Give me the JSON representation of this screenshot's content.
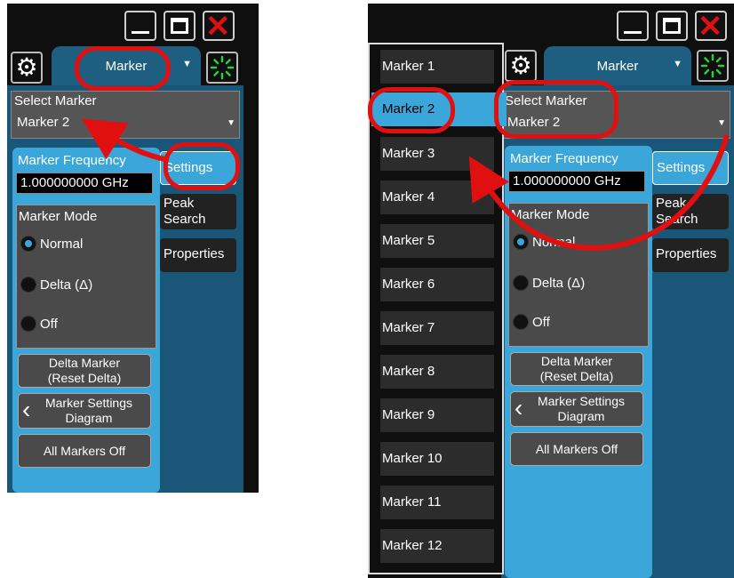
{
  "left": {
    "tab_label": "Marker",
    "select_marker": {
      "label": "Select Marker",
      "value": "Marker 2"
    },
    "marker_frequency": {
      "label": "Marker Frequency",
      "value": "1.000000000 GHz"
    },
    "marker_mode": {
      "label": "Marker Mode",
      "options": [
        "Normal",
        "Delta (Δ)",
        "Off"
      ],
      "selected": "Normal"
    },
    "buttons": {
      "delta_marker": "Delta Marker\n(Reset Delta)",
      "settings_diagram": "Marker Settings\nDiagram",
      "all_off": "All Markers Off"
    },
    "side_tabs": {
      "settings": "Settings",
      "peak_search": "Peak\nSearch",
      "properties": "Properties"
    }
  },
  "right": {
    "tab_label": "Marker",
    "select_marker": {
      "label": "Select Marker",
      "value": "Marker 2"
    },
    "marker_frequency": {
      "label": "Marker Frequency",
      "value": "1.000000000 GHz"
    },
    "marker_mode": {
      "label": "Marker Mode",
      "options": [
        "Normal",
        "Delta (Δ)",
        "Off"
      ],
      "selected": "Normal"
    },
    "buttons": {
      "delta_marker": "Delta Marker\n(Reset Delta)",
      "settings_diagram": "Marker Settings\nDiagram",
      "all_off": "All Markers Off"
    },
    "side_tabs": {
      "settings": "Settings",
      "peak_search": "Peak\nSearch",
      "properties": "Properties"
    },
    "marker_list": [
      "Marker 1",
      "Marker 2",
      "Marker 3",
      "Marker 4",
      "Marker 5",
      "Marker 6",
      "Marker 7",
      "Marker 8",
      "Marker 9",
      "Marker 10",
      "Marker 11",
      "Marker 12"
    ],
    "marker_list_selected": "Marker 2"
  },
  "icons": {
    "gear": "gear-icon",
    "spinner": "spinner-icon",
    "minimize": "minimize-icon",
    "maximize": "maximize-icon",
    "close": "close-icon",
    "chevron": "chevron-left-icon",
    "dropdown": "dropdown-arrow-icon"
  },
  "colors": {
    "accent": "#3ba6da",
    "tab": "#1e5e80",
    "annotation": "#e01010",
    "spinner": "#2ecc40"
  }
}
